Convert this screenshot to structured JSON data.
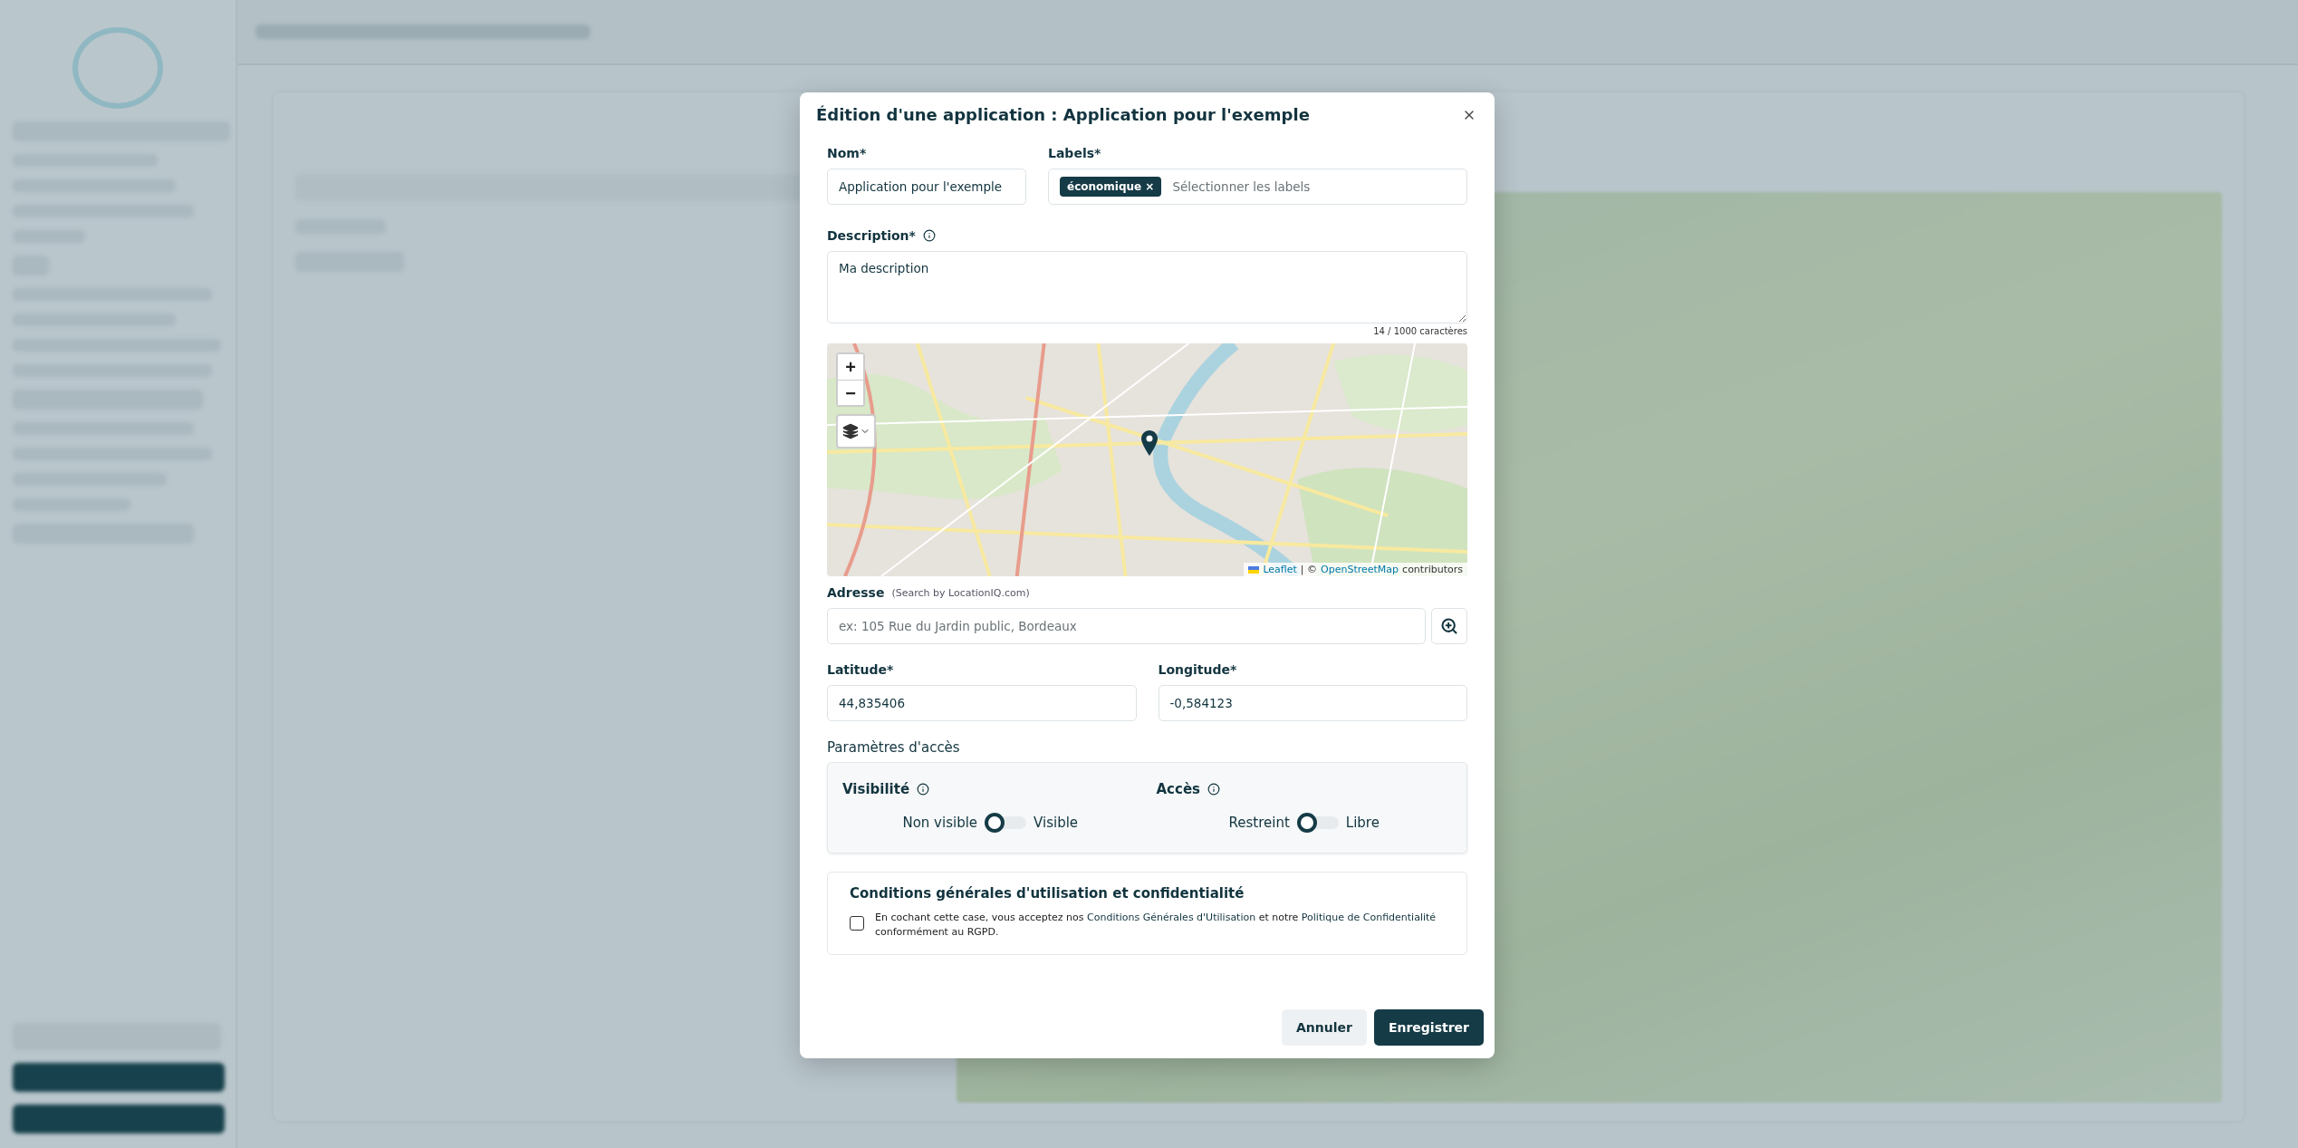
{
  "dialog": {
    "title": "Édition d'une application : Application pour l'exemple"
  },
  "name_field": {
    "label": "Nom*",
    "value": "Application pour l'exemple"
  },
  "labels_field": {
    "label": "Labels*",
    "tags": [
      {
        "text": "économique",
        "remove": "×"
      }
    ],
    "placeholder": "Sélectionner les labels"
  },
  "description_field": {
    "label": "Description*",
    "value": "Ma description",
    "counter": "14 / 1000 caractères"
  },
  "map": {
    "zoom_in": "+",
    "zoom_out": "−",
    "attribution": {
      "leaflet": "Leaflet",
      "separator": "| ©",
      "osm": "OpenStreetMap",
      "rest": "contributors"
    }
  },
  "address_field": {
    "label": "Adresse",
    "hint": "(Search by LocationIQ.com)",
    "placeholder": "ex: 105 Rue du Jardin public, Bordeaux"
  },
  "coordinates": [
    {
      "label": "Latitude*",
      "value": "44,835406"
    },
    {
      "label": "Longitude*",
      "value": "-0,584123"
    }
  ],
  "access": {
    "title": "Paramètres d'accès",
    "groups": [
      {
        "label": "Visibilité",
        "off_label": "Non visible",
        "on_label": "Visible",
        "on": false
      },
      {
        "label": "Accès",
        "off_label": "Restreint",
        "on_label": "Libre",
        "on": false
      }
    ]
  },
  "terms": {
    "title": "Conditions générales d'utilisation et confidentialité",
    "checked": false,
    "before": "En cochant cette case, vous acceptez nos",
    "link_1": "Conditions Générales d'Utilisation",
    "middle": "et notre",
    "link_2": "Politique de Confidentialité",
    "after": "conformément au RGPD."
  },
  "buttons": [
    {
      "kind": "secondary",
      "label": "Annuler"
    },
    {
      "kind": "primary",
      "label": "Enregistrer"
    }
  ]
}
